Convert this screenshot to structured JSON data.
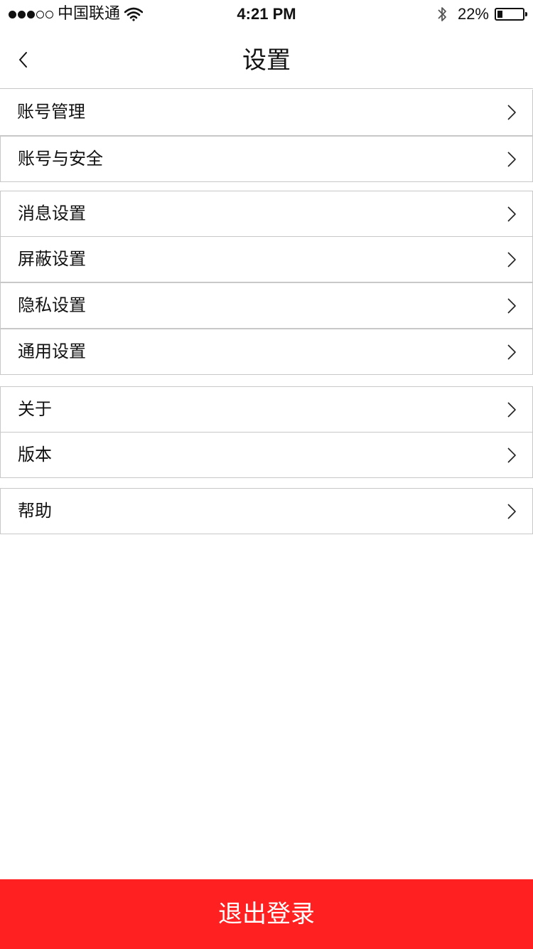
{
  "status_bar": {
    "carrier": "中国联通",
    "time": "4:21 PM",
    "battery_percent": "22%",
    "battery_level": 0.22,
    "signal_strength": 3,
    "signal_max": 5,
    "icons": [
      "wifi-icon",
      "bluetooth-icon",
      "battery-icon"
    ]
  },
  "nav": {
    "title": "设置",
    "back_icon": "chevron-left-icon"
  },
  "settings": {
    "items": [
      {
        "label": "账号管理",
        "icon": "chevron-right-icon"
      },
      {
        "label": "账号与安全",
        "icon": "chevron-right-icon"
      },
      {
        "label": "消息设置",
        "icon": "chevron-right-icon"
      },
      {
        "label": "屏蔽设置",
        "icon": "chevron-right-icon"
      },
      {
        "label": "隐私设置",
        "icon": "chevron-right-icon"
      },
      {
        "label": "通用设置",
        "icon": "chevron-right-icon"
      },
      {
        "label": "关于",
        "icon": "chevron-right-icon"
      },
      {
        "label": "版本",
        "icon": "chevron-right-icon"
      },
      {
        "label": "帮助",
        "icon": "chevron-right-icon"
      }
    ]
  },
  "logout": {
    "label": "退出登录",
    "background_color": "#ff2121",
    "text_color": "#ffffff"
  }
}
